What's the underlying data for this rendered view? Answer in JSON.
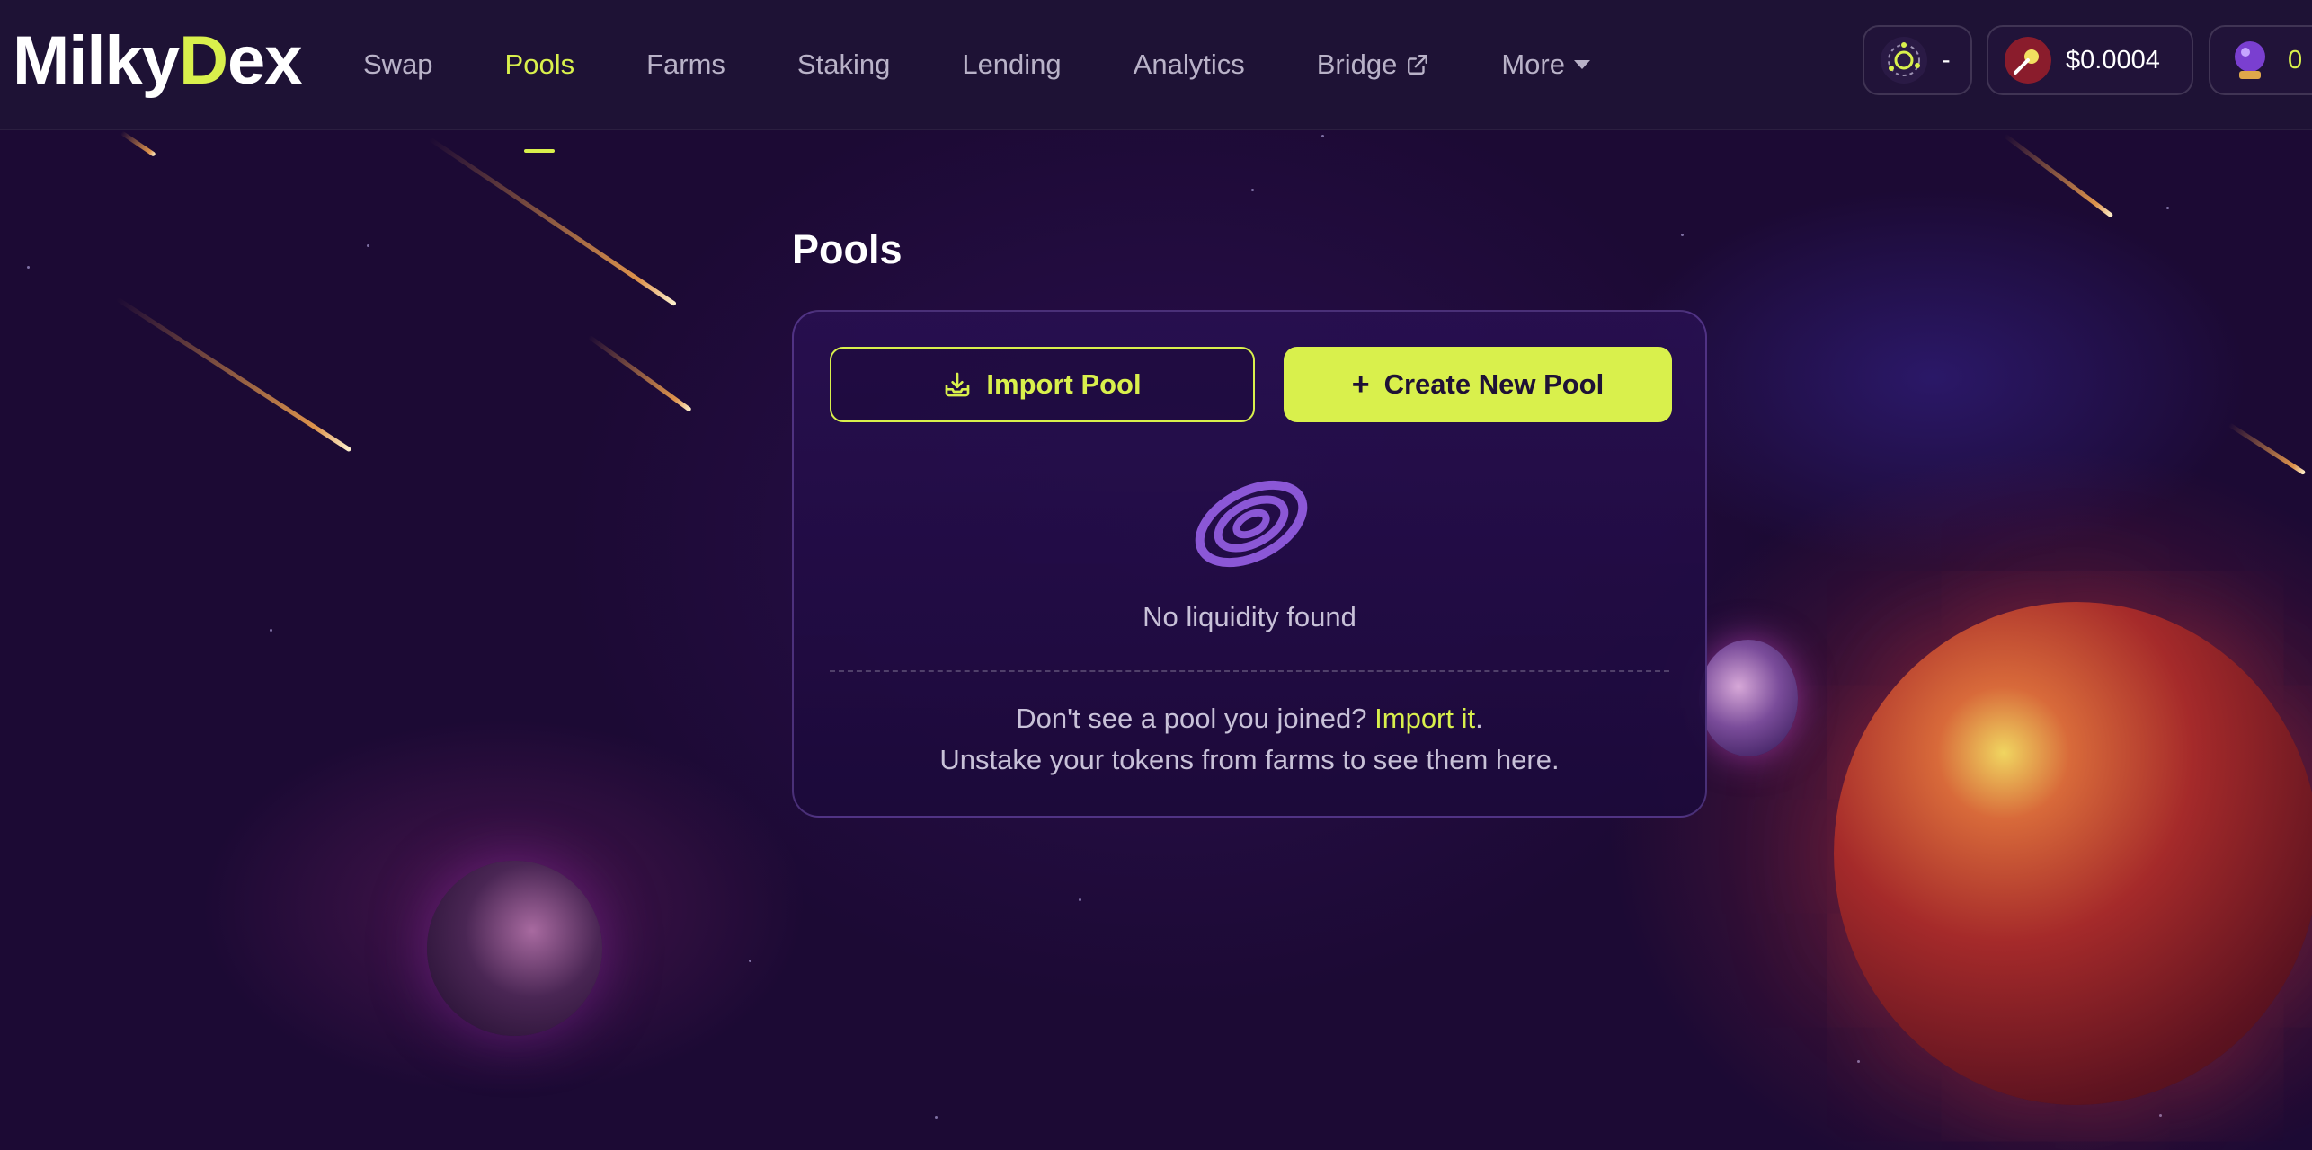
{
  "brand": {
    "logo_left": "Milky",
    "logo_mark": "D",
    "logo_right": "ex"
  },
  "nav": {
    "items": [
      {
        "label": "Swap"
      },
      {
        "label": "Pools"
      },
      {
        "label": "Farms"
      },
      {
        "label": "Staking"
      },
      {
        "label": "Lending"
      },
      {
        "label": "Analytics"
      },
      {
        "label": "Bridge"
      },
      {
        "label": "More"
      }
    ],
    "active": "Pools"
  },
  "header_right": {
    "network_value": "-",
    "token_price": "$0.0004",
    "balance_value": "0"
  },
  "page": {
    "title": "Pools"
  },
  "pools_card": {
    "import_button": "Import Pool",
    "create_button": "Create New Pool",
    "empty_text": "No liquidity found",
    "hint_prefix": "Don't see a pool you joined?",
    "hint_link": "Import it",
    "hint_suffix": ".",
    "hint_line2": "Unstake your tokens from farms to see them here."
  },
  "colors": {
    "accent": "#d9f04c",
    "background": "#1d0c36",
    "header": "#1e1235"
  }
}
